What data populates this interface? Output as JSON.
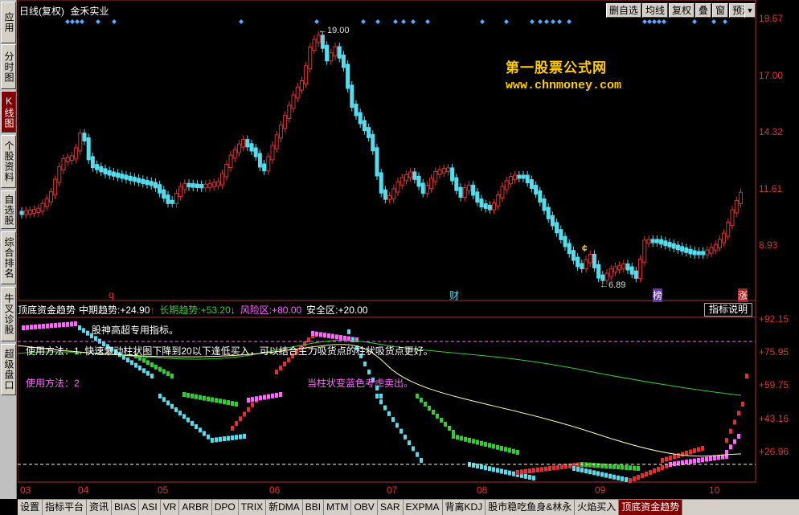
{
  "sidebar": {
    "tabs": [
      {
        "label": "应用",
        "active": false
      },
      {
        "label": "分时图",
        "active": false
      },
      {
        "label": "K线图",
        "active": true
      },
      {
        "label": "个股资料",
        "active": false
      },
      {
        "label": "自选股",
        "active": false
      },
      {
        "label": "综合排名",
        "active": false
      },
      {
        "label": "牛叉诊股",
        "active": false
      },
      {
        "label": "超级盘口",
        "active": false
      }
    ]
  },
  "main": {
    "title": "日线(复权)",
    "stock": "金禾实业"
  },
  "toolbar": [
    "删自选",
    "均线",
    "复权",
    "叠",
    "窗",
    "预测"
  ],
  "watermark": {
    "line1": "第一股票公式网",
    "line2": "www.chnmoney.com"
  },
  "price_axis": [
    "19.67",
    "17.00",
    "14.32",
    "11.61",
    "8.93"
  ],
  "price_labels": {
    "high": "19.00",
    "low": "6.89"
  },
  "event_marks": {
    "q": "q",
    "cai": "财",
    "bang": "榜",
    "zhang": "涨"
  },
  "indicator": {
    "name": "顶底资金趋势",
    "items": [
      {
        "label": "中期趋势:",
        "value": "+24.90",
        "arrow": "↑",
        "color": "#ffffff"
      },
      {
        "label": "长期趋势:",
        "value": "+53.20",
        "arrow": "↓",
        "color": "#33cc33"
      },
      {
        "label": "风险区:",
        "value": "+80.00",
        "arrow": "",
        "color": "#ff66ff"
      },
      {
        "label": "安全区:",
        "value": "+20.00",
        "arrow": "",
        "color": "#ffffff"
      }
    ],
    "help_button": "指标说明",
    "axis": [
      "+92.15",
      "+75.95",
      "+59.75",
      "+43.16",
      "+26.96"
    ]
  },
  "notes": {
    "n1": "股神高超专用指标。",
    "n2": "使用方法：1. 快速紫动柱状图下降到20以下逢低买入，可以结合主力吸货点的柱状吸货点更好。",
    "n3": "使用方法：2",
    "n4": "当柱状变蓝色考虑卖出。"
  },
  "x_axis": [
    "03",
    "04",
    "05",
    "06",
    "07",
    "08",
    "09",
    "10"
  ],
  "bottom_tabs": [
    {
      "label": "设置",
      "active": false
    },
    {
      "label": "指标平台",
      "active": false
    },
    {
      "label": "资讯",
      "active": false
    },
    {
      "label": "BIAS",
      "active": false
    },
    {
      "label": "ASI",
      "active": false
    },
    {
      "label": "VR",
      "active": false
    },
    {
      "label": "ARBR",
      "active": false
    },
    {
      "label": "DPO",
      "active": false
    },
    {
      "label": "TRIX",
      "active": false
    },
    {
      "label": "新DMA",
      "active": false
    },
    {
      "label": "BBI",
      "active": false
    },
    {
      "label": "MTM",
      "active": false
    },
    {
      "label": "OBV",
      "active": false
    },
    {
      "label": "SAR",
      "active": false
    },
    {
      "label": "EXPMA",
      "active": false
    },
    {
      "label": "背离KDJ",
      "active": false
    },
    {
      "label": "股市稳吃鱼身&林永",
      "active": false
    },
    {
      "label": "火焰买入",
      "active": false
    },
    {
      "label": "顶底资金趋势",
      "active": true
    }
  ],
  "colors": {
    "up": "#e03030",
    "down": "#55ddee",
    "risk": "#ff66ff",
    "safe": "#ffffaa",
    "long": "#33cc33",
    "mid": "#ffffaa"
  }
}
